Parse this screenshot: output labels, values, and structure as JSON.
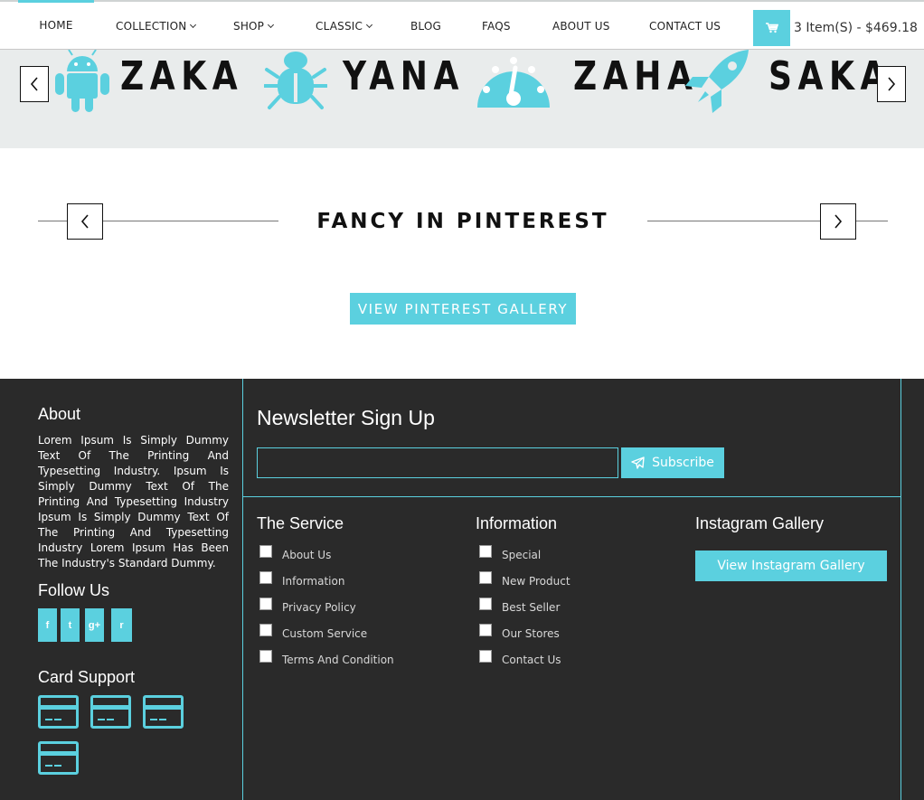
{
  "nav": {
    "items": [
      {
        "label": "HOME",
        "dropdown": false
      },
      {
        "label": "COLLECTION",
        "dropdown": true
      },
      {
        "label": "SHOP",
        "dropdown": true
      },
      {
        "label": "CLASSIC",
        "dropdown": true
      },
      {
        "label": "BLOG",
        "dropdown": false
      },
      {
        "label": "FAQS",
        "dropdown": false
      },
      {
        "label": "ABOUT US",
        "dropdown": false
      },
      {
        "label": "CONTACT US",
        "dropdown": false
      }
    ],
    "active": "HOME",
    "cart": {
      "icon": "cart-icon",
      "summary": "3 Item(S) - $469.18"
    }
  },
  "brands": {
    "items": [
      {
        "name": "ZAKA",
        "icon": "android-icon"
      },
      {
        "name": "YANA",
        "icon": "bug-icon"
      },
      {
        "name": "ZAHA",
        "icon": "speedometer-icon"
      },
      {
        "name": "SAKA",
        "icon": "rocket-icon"
      }
    ]
  },
  "pinterest": {
    "title": "FANCY IN PINTEREST",
    "button": "VIEW PINTEREST GALLERY"
  },
  "footer": {
    "about": {
      "heading": "About",
      "text": "Lorem Ipsum Is Simply Dummy Text Of The Printing And Typesetting Industry. Ipsum Is Simply Dummy Text Of The Printing And Typesetting Industry Ipsum Is Simply Dummy Text Of The Printing And Typesetting Industry Lorem Ipsum Has Been The Industry's Standard Dummy."
    },
    "follow": {
      "heading": "Follow Us",
      "icons": [
        "facebook-icon",
        "twitter-icon",
        "google-plus-icon",
        "rss-icon"
      ],
      "glyphs": [
        "f",
        "t",
        "g+",
        "r"
      ]
    },
    "cards": {
      "heading": "Card Support"
    },
    "newsletter": {
      "heading": "Newsletter Sign Up",
      "value": "",
      "button": "Subscribe"
    },
    "service": {
      "heading": "The Service",
      "links": [
        "About Us",
        "Information",
        "Privacy Policy",
        "Custom Service",
        "Terms And Condition"
      ]
    },
    "information": {
      "heading": "Information",
      "links": [
        "Special",
        "New Product",
        "Best Seller",
        "Our Stores",
        "Contact Us"
      ]
    },
    "instagram": {
      "heading": "Instagram Gallery",
      "button": "View Instagram Gallery"
    }
  },
  "colors": {
    "accent": "#5bd0df",
    "footer_bg": "#2a2a2a",
    "strip_bg": "#e9ecec"
  }
}
